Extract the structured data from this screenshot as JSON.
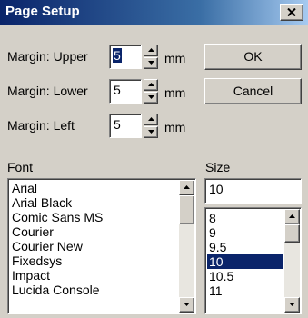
{
  "window": {
    "title": "Page Setup"
  },
  "margins": {
    "upper": {
      "label": "Margin: Upper",
      "value": "5",
      "unit": "mm"
    },
    "lower": {
      "label": "Margin: Lower",
      "value": "5",
      "unit": "mm"
    },
    "left": {
      "label": "Margin: Left",
      "value": "5",
      "unit": "mm"
    }
  },
  "buttons": {
    "ok": "OK",
    "cancel": "Cancel"
  },
  "font": {
    "label": "Font",
    "items": [
      "Arial",
      "Arial Black",
      "Comic Sans MS",
      "Courier",
      "Courier New",
      "Fixedsys",
      "Impact",
      "Lucida Console"
    ]
  },
  "size": {
    "label": "Size",
    "value": "10",
    "items": [
      "8",
      "9",
      "9.5",
      "10",
      "10.5",
      "11"
    ],
    "selected": "10"
  },
  "colors": {
    "title_start": "#0a246a",
    "title_end": "#a6caf0",
    "selection": "#0a246a",
    "face": "#d4d0c8"
  }
}
